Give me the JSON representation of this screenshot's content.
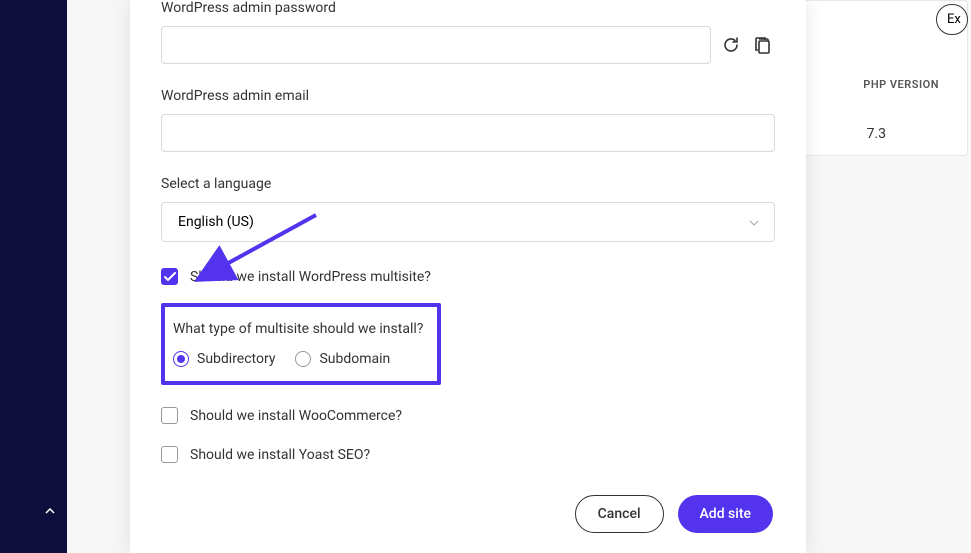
{
  "background": {
    "ex_button_label": "Ex",
    "php_version_header": "PHP VERSION",
    "php_version_value": "7.3"
  },
  "form": {
    "password_label": "WordPress admin password",
    "password_value": "",
    "email_label": "WordPress admin email",
    "email_value": "",
    "language_label": "Select a language",
    "language_value": "English (US)",
    "multisite_checkbox_label": "Should we install WordPress multisite?",
    "multisite_type_label": "What type of multisite should we install?",
    "radio_subdirectory": "Subdirectory",
    "radio_subdomain": "Subdomain",
    "woocommerce_label": "Should we install WooCommerce?",
    "yoast_label": "Should we install Yoast SEO?"
  },
  "buttons": {
    "cancel": "Cancel",
    "add_site": "Add site"
  },
  "colors": {
    "accent": "#5333ed",
    "dark_bg": "#0e0e3c"
  }
}
